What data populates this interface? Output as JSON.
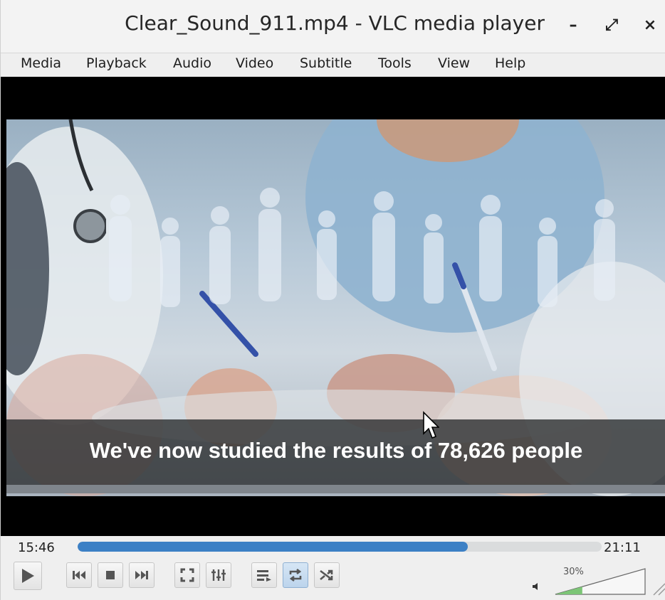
{
  "window": {
    "title": "Clear_Sound_911.mp4 - VLC media player",
    "minimize_glyph": "–",
    "maximize_glyph": "⤢",
    "close_glyph": "×"
  },
  "menu": {
    "items": [
      {
        "label": "Media"
      },
      {
        "label": "Playback"
      },
      {
        "label": "Audio"
      },
      {
        "label": "Video"
      },
      {
        "label": "Subtitle"
      },
      {
        "label": "Tools"
      },
      {
        "label": "View"
      },
      {
        "label": "Help"
      }
    ]
  },
  "video": {
    "subtitle": "We've now studied the results of 78,626 people"
  },
  "playback": {
    "elapsed": "15:46",
    "total": "21:11",
    "progress_fraction": 0.745
  },
  "controls": {
    "icons": [
      "play-icon",
      "previous-icon",
      "stop-icon",
      "next-icon",
      "fullscreen-icon",
      "extended-settings-icon",
      "playlist-icon",
      "loop-icon",
      "shuffle-icon"
    ],
    "loop_active": true
  },
  "volume": {
    "label": "30%",
    "level": 0.3
  },
  "colors": {
    "accent": "#3c80c5",
    "volume": "#7cc576"
  }
}
